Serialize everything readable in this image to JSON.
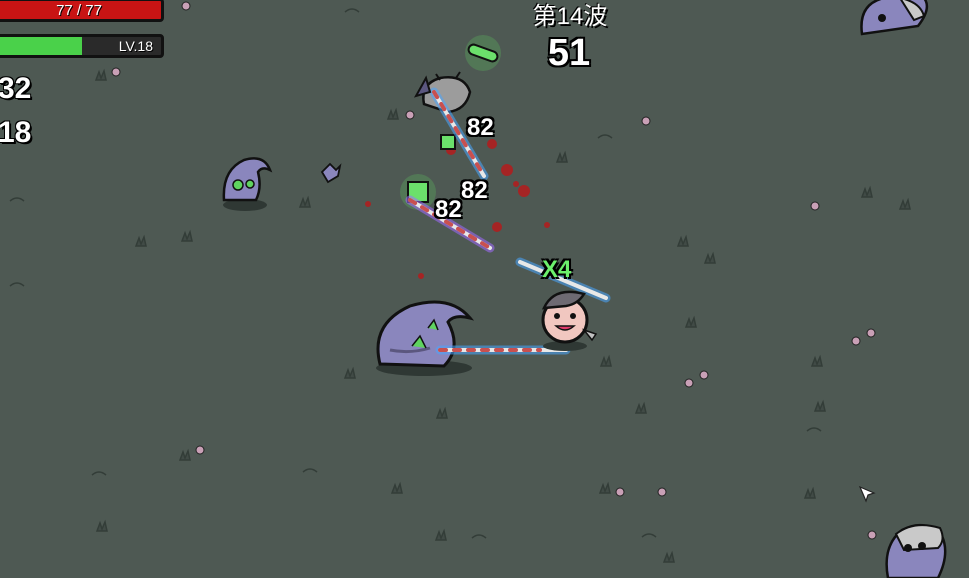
{
  "hud": {
    "hp": {
      "text": "77 / 77",
      "current": 77,
      "max": 77
    },
    "xp": {
      "level_text": "LV.18",
      "fill_fraction": 0.52
    },
    "materials": "32",
    "bag": "18"
  },
  "wave": {
    "title": "第14波",
    "timer": "51"
  },
  "damage_numbers": [
    "82",
    "82",
    "82"
  ],
  "combo": "X4",
  "colors": {
    "ground": "#4e5953",
    "enemy": "#8a86bd",
    "enemy_glow": "#5fd35f",
    "hp": "#c81414",
    "xp": "#4ad14a",
    "spear_glow": "#4aa6ff"
  }
}
